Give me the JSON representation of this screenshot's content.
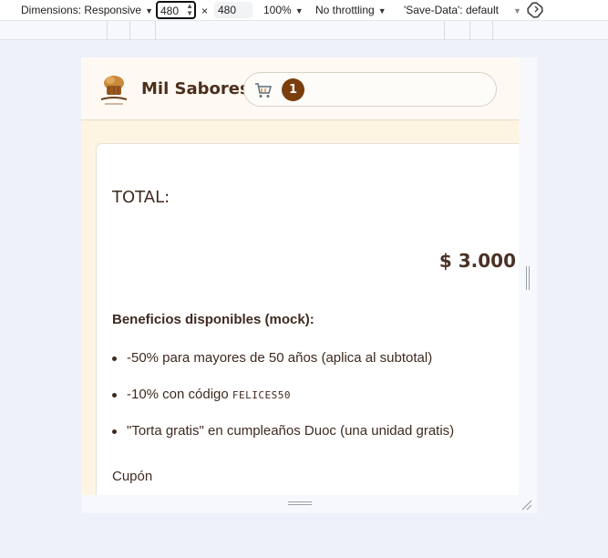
{
  "devtools": {
    "dimensions_label": "Dimensions: Responsive",
    "width_value": "480",
    "times_sign": "×",
    "height_value": "480",
    "zoom": "100%",
    "throttling": "No throttling",
    "save_data": "'Save-Data': default"
  },
  "app": {
    "brand": "Mil Sabores",
    "cart_count": "1",
    "total_label": "TOTAL:",
    "total_value": "$ 3.000",
    "benefits_title": "Beneficios disponibles (mock):",
    "benefits": [
      "-50% para mayores de 50 años (aplica al subtotal)",
      "-10% con código",
      "\"Torta gratis\" en cumpleaños Duoc (una unidad gratis)"
    ],
    "coupon_code": "FELICES50",
    "coupon_label": "Cupón"
  },
  "colors": {
    "accent": "#7a3e0d",
    "brand_text": "#4d2e1c",
    "page_bg": "#fdf4e2"
  }
}
